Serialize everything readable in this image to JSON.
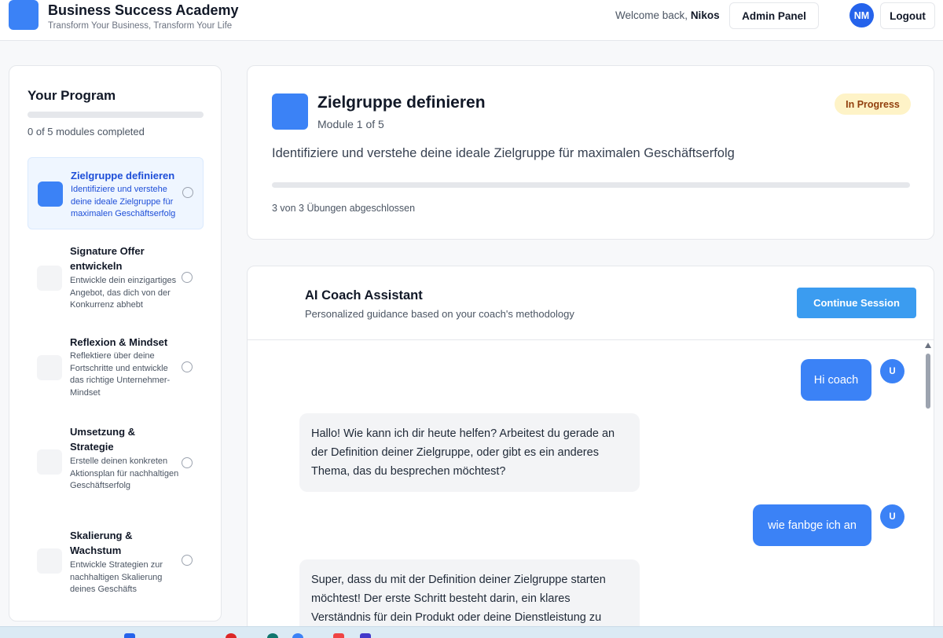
{
  "header": {
    "brand_title": "Business Success Academy",
    "brand_subtitle": "Transform Your Business, Transform Your Life",
    "welcome_prefix": "Welcome back,",
    "user_name": "Nikos",
    "admin_label": "Admin Panel",
    "avatar_initials": "NM",
    "logout_label": "Logout"
  },
  "sidebar": {
    "title": "Your Program",
    "progress_fraction": 0,
    "progress_text": "0 of 5 modules completed",
    "modules": [
      {
        "title": "Zielgruppe definieren",
        "description": "Identifiziere und verstehe deine ideale Zielgruppe für maximalen Geschäftserfolg",
        "active": true
      },
      {
        "title": "Signature Offer entwickeln",
        "description": "Entwickle dein einzigartiges Angebot, das dich von der Konkurrenz abhebt",
        "active": false
      },
      {
        "title": "Reflexion & Mindset",
        "description": "Reflektiere über deine Fortschritte und entwickle das richtige Unternehmer-Mindset",
        "active": false
      },
      {
        "title": "Umsetzung & Strategie",
        "description": "Erstelle deinen konkreten Aktionsplan für nachhaltigen Geschäftserfolg",
        "active": false
      },
      {
        "title": "Skalierung & Wachstum",
        "description": "Entwickle Strategien zur nachhaltigen Skalierung deines Geschäfts",
        "active": false
      }
    ]
  },
  "module_card": {
    "title": "Zielgruppe definieren",
    "subtitle": "Module 1 of 5",
    "status": "In Progress",
    "description": "Identifiziere und verstehe deine ideale Zielgruppe für maximalen Geschäftserfolg",
    "progress_fraction": 0,
    "progress_text": "3 von 3 Übungen abgeschlossen"
  },
  "coach": {
    "title": "AI Coach Assistant",
    "subtitle": "Personalized guidance based on your coach's methodology",
    "continue_label": "Continue Session",
    "user_avatar": "U",
    "messages": [
      {
        "role": "user",
        "text": "Hi coach"
      },
      {
        "role": "assistant",
        "text": "Hallo! Wie kann ich dir heute helfen? Arbeitest du gerade an der Definition deiner Zielgruppe, oder gibt es ein anderes Thema, das du besprechen möchtest?"
      },
      {
        "role": "user",
        "text": "wie fanbge ich an"
      },
      {
        "role": "assistant",
        "text": "Super, dass du mit der Definition deiner Zielgruppe starten möchtest! Der erste Schritt besteht darin, ein klares Verständnis für dein Produkt oder deine Dienstleistung zu"
      }
    ]
  },
  "colors": {
    "accent": "#3b82f6",
    "badge_bg": "#fef3c7",
    "badge_text": "#92400e",
    "continue_bg": "#3b9cf0"
  }
}
